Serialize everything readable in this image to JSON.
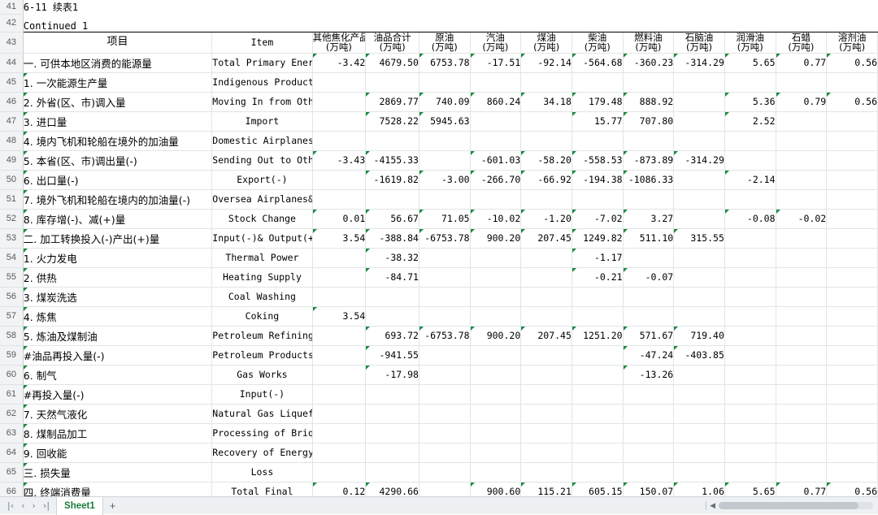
{
  "workbook": {
    "sheet_tab": "Sheet1",
    "add_sheet_label": "+",
    "nav_first": "|‹",
    "nav_prev": "‹",
    "nav_next": "›",
    "nav_last": "›|"
  },
  "titles": {
    "table_no": "6-11  续表1",
    "continued": "Continued 1"
  },
  "row_numbers": [
    "41",
    "42",
    "43",
    "44",
    "45",
    "46",
    "47",
    "48",
    "49",
    "50",
    "51",
    "52",
    "53",
    "54",
    "55",
    "56",
    "57",
    "58",
    "59",
    "60",
    "61",
    "62",
    "63",
    "64",
    "65",
    "66"
  ],
  "headers": {
    "item_cn": "项目",
    "item_en": "Item",
    "columns": [
      {
        "cn": "其他焦化产品",
        "unit": "(万吨)"
      },
      {
        "cn": "油品合计",
        "unit": "(万吨)"
      },
      {
        "cn": "原油",
        "unit": "(万吨)"
      },
      {
        "cn": "汽油",
        "unit": "(万吨)"
      },
      {
        "cn": "煤油",
        "unit": "(万吨)"
      },
      {
        "cn": "柴油",
        "unit": "(万吨)"
      },
      {
        "cn": "燃料油",
        "unit": "(万吨)"
      },
      {
        "cn": "石脑油",
        "unit": "(万吨)"
      },
      {
        "cn": "润滑油",
        "unit": "(万吨)"
      },
      {
        "cn": "石蜡",
        "unit": "(万吨)"
      },
      {
        "cn": "溶剂油",
        "unit": "(万吨)"
      }
    ]
  },
  "rows": [
    {
      "row": "44",
      "cn": "一. 可供本地区消费的能源量",
      "en": "Total Primary Energy Supply",
      "bold": true,
      "indent": 0,
      "values": [
        "-3.42",
        "4679.50",
        "6753.78",
        "-17.51",
        "-92.14",
        "-564.68",
        "-360.23",
        "-314.29",
        "5.65",
        "0.77",
        "0.56"
      ]
    },
    {
      "row": "45",
      "cn": "1. 一次能源生产量",
      "en": "Indigenous Production",
      "bold": false,
      "indent": 1,
      "values": [
        "",
        "",
        "",
        "",
        "",
        "",
        "",
        "",
        "",
        "",
        ""
      ]
    },
    {
      "row": "46",
      "cn": "2. 外省(区、市)调入量",
      "en": "Moving In from Other Provinces",
      "bold": false,
      "indent": 1,
      "values": [
        "",
        "2869.77",
        "740.09",
        "860.24",
        "34.18",
        "179.48",
        "888.92",
        "",
        "5.36",
        "0.79",
        "0.56"
      ]
    },
    {
      "row": "47",
      "cn": "3. 进口量",
      "en": "Import",
      "bold": false,
      "indent": 1,
      "values": [
        "",
        "7528.22",
        "5945.63",
        "",
        "",
        "15.77",
        "707.80",
        "",
        "2.52",
        "",
        ""
      ]
    },
    {
      "row": "48",
      "cn": "4. 境内飞机和轮船在境外的加油量",
      "en": "Domestic Airplanes&Ships",
      "bold": false,
      "indent": 1,
      "values": [
        "",
        "",
        "",
        "",
        "",
        "",
        "",
        "",
        "",
        "",
        ""
      ]
    },
    {
      "row": "49",
      "cn": "5. 本省(区、市)调出量(-)",
      "en": "Sending Out to Other Provinces(-)",
      "bold": false,
      "indent": 1,
      "values": [
        "-3.43",
        "-4155.33",
        "",
        "-601.03",
        "-58.20",
        "-558.53",
        "-873.89",
        "-314.29",
        "",
        "",
        ""
      ]
    },
    {
      "row": "50",
      "cn": "6. 出口量(-)",
      "en": "Export(-)",
      "bold": false,
      "indent": 1,
      "values": [
        "",
        "-1619.82",
        "-3.00",
        "-266.70",
        "-66.92",
        "-194.38",
        "-1086.33",
        "",
        "-2.14",
        "",
        ""
      ]
    },
    {
      "row": "51",
      "cn": "7. 境外飞机和轮船在境内的加油量(-)",
      "en": "Oversea Airplanes&Ships",
      "bold": false,
      "indent": 1,
      "values": [
        "",
        "",
        "",
        "",
        "",
        "",
        "",
        "",
        "",
        "",
        ""
      ]
    },
    {
      "row": "52",
      "cn": "8. 库存增(-)、减(+)量",
      "en": "Stock Change",
      "bold": false,
      "indent": 1,
      "values": [
        "0.01",
        "56.67",
        "71.05",
        "-10.02",
        "-1.20",
        "-7.02",
        "3.27",
        "",
        "-0.08",
        "-0.02",
        ""
      ]
    },
    {
      "row": "53",
      "cn": "二. 加工转换投入(-)产出(+)量",
      "en": "Input(-)& Output(+)of",
      "bold": true,
      "indent": 0,
      "values": [
        "3.54",
        "-388.84",
        "-6753.78",
        "900.20",
        "207.45",
        "1249.82",
        "511.10",
        "315.55",
        "",
        "",
        ""
      ]
    },
    {
      "row": "54",
      "cn": "1. 火力发电",
      "en": "Thermal Power",
      "bold": false,
      "indent": 1,
      "values": [
        "",
        "-38.32",
        "",
        "",
        "",
        "-1.17",
        "",
        "",
        "",
        "",
        ""
      ]
    },
    {
      "row": "55",
      "cn": "2. 供热",
      "en": "Heating Supply",
      "bold": false,
      "indent": 1,
      "values": [
        "",
        "-84.71",
        "",
        "",
        "",
        "-0.21",
        "-0.07",
        "",
        "",
        "",
        ""
      ]
    },
    {
      "row": "56",
      "cn": "3. 煤炭洗选",
      "en": "Coal Washing",
      "bold": false,
      "indent": 1,
      "values": [
        "",
        "",
        "",
        "",
        "",
        "",
        "",
        "",
        "",
        "",
        ""
      ]
    },
    {
      "row": "57",
      "cn": "4. 炼焦",
      "en": "Coking",
      "bold": false,
      "indent": 1,
      "values": [
        "3.54",
        "",
        "",
        "",
        "",
        "",
        "",
        "",
        "",
        "",
        ""
      ]
    },
    {
      "row": "58",
      "cn": "5. 炼油及煤制油",
      "en": "Petroleum Refining and Coal-",
      "bold": false,
      "indent": 1,
      "values": [
        "",
        "693.72",
        "-6753.78",
        "900.20",
        "207.45",
        "1251.20",
        "571.67",
        "719.40",
        "",
        "",
        ""
      ]
    },
    {
      "row": "59",
      "cn": "#油品再投入量(-)",
      "en": "Petroleum Products Input(-)",
      "bold": false,
      "indent": 2,
      "values": [
        "",
        "-941.55",
        "",
        "",
        "",
        "",
        "-47.24",
        "-403.85",
        "",
        "",
        ""
      ]
    },
    {
      "row": "60",
      "cn": "6. 制气",
      "en": "Gas Works",
      "bold": false,
      "indent": 1,
      "values": [
        "",
        "-17.98",
        "",
        "",
        "",
        "",
        "-13.26",
        "",
        "",
        "",
        ""
      ]
    },
    {
      "row": "61",
      "cn": "#再投入量(-)",
      "en": "Input(-)",
      "bold": false,
      "indent": 2,
      "values": [
        "",
        "",
        "",
        "",
        "",
        "",
        "",
        "",
        "",
        "",
        ""
      ]
    },
    {
      "row": "62",
      "cn": "7. 天然气液化",
      "en": "Natural Gas Liquefaction",
      "bold": false,
      "indent": 1,
      "values": [
        "",
        "",
        "",
        "",
        "",
        "",
        "",
        "",
        "",
        "",
        ""
      ]
    },
    {
      "row": "63",
      "cn": "8. 煤制品加工",
      "en": "Processing of Briquettes",
      "bold": false,
      "indent": 1,
      "values": [
        "",
        "",
        "",
        "",
        "",
        "",
        "",
        "",
        "",
        "",
        ""
      ]
    },
    {
      "row": "64",
      "cn": "9. 回收能",
      "en": "Recovery of Energy",
      "bold": false,
      "indent": 1,
      "values": [
        "",
        "",
        "",
        "",
        "",
        "",
        "",
        "",
        "",
        "",
        ""
      ]
    },
    {
      "row": "65",
      "cn": "三. 损失量",
      "en": "Loss",
      "bold": true,
      "indent": 0,
      "values": [
        "",
        "",
        "",
        "",
        "",
        "",
        "",
        "",
        "",
        "",
        ""
      ]
    },
    {
      "row": "66",
      "cn": "四. 终端消费量",
      "en": "Total Final",
      "bold": true,
      "indent": 0,
      "values": [
        "0.12",
        "4290.66",
        "",
        "900.60",
        "115.21",
        "605.15",
        "150.07",
        "1.06",
        "5.65",
        "0.77",
        "0.56"
      ]
    }
  ],
  "comment_marker_color": "#1a8a42"
}
